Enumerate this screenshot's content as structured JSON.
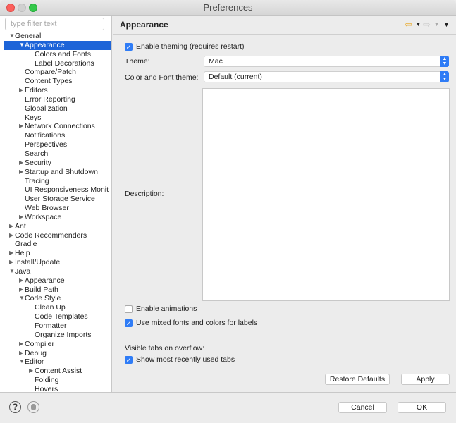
{
  "window": {
    "title": "Preferences"
  },
  "sidebar": {
    "filter_placeholder": "type filter text",
    "items": [
      {
        "label": "General",
        "level": 0,
        "state": "expanded"
      },
      {
        "label": "Appearance",
        "level": 1,
        "state": "expanded",
        "selected": true
      },
      {
        "label": "Colors and Fonts",
        "level": 2,
        "state": "leaf"
      },
      {
        "label": "Label Decorations",
        "level": 2,
        "state": "leaf"
      },
      {
        "label": "Compare/Patch",
        "level": 1,
        "state": "leaf"
      },
      {
        "label": "Content Types",
        "level": 1,
        "state": "leaf"
      },
      {
        "label": "Editors",
        "level": 1,
        "state": "collapsed"
      },
      {
        "label": "Error Reporting",
        "level": 1,
        "state": "leaf"
      },
      {
        "label": "Globalization",
        "level": 1,
        "state": "leaf"
      },
      {
        "label": "Keys",
        "level": 1,
        "state": "leaf"
      },
      {
        "label": "Network Connections",
        "level": 1,
        "state": "collapsed"
      },
      {
        "label": "Notifications",
        "level": 1,
        "state": "leaf"
      },
      {
        "label": "Perspectives",
        "level": 1,
        "state": "leaf"
      },
      {
        "label": "Search",
        "level": 1,
        "state": "leaf"
      },
      {
        "label": "Security",
        "level": 1,
        "state": "collapsed"
      },
      {
        "label": "Startup and Shutdown",
        "level": 1,
        "state": "collapsed"
      },
      {
        "label": "Tracing",
        "level": 1,
        "state": "leaf"
      },
      {
        "label": "UI Responsiveness Monit",
        "level": 1,
        "state": "leaf"
      },
      {
        "label": "User Storage Service",
        "level": 1,
        "state": "leaf"
      },
      {
        "label": "Web Browser",
        "level": 1,
        "state": "leaf"
      },
      {
        "label": "Workspace",
        "level": 1,
        "state": "collapsed"
      },
      {
        "label": "Ant",
        "level": 0,
        "state": "collapsed"
      },
      {
        "label": "Code Recommenders",
        "level": 0,
        "state": "collapsed"
      },
      {
        "label": "Gradle",
        "level": 0,
        "state": "leaf"
      },
      {
        "label": "Help",
        "level": 0,
        "state": "collapsed"
      },
      {
        "label": "Install/Update",
        "level": 0,
        "state": "collapsed"
      },
      {
        "label": "Java",
        "level": 0,
        "state": "expanded"
      },
      {
        "label": "Appearance",
        "level": 1,
        "state": "collapsed"
      },
      {
        "label": "Build Path",
        "level": 1,
        "state": "collapsed"
      },
      {
        "label": "Code Style",
        "level": 1,
        "state": "expanded"
      },
      {
        "label": "Clean Up",
        "level": 2,
        "state": "leaf"
      },
      {
        "label": "Code Templates",
        "level": 2,
        "state": "leaf"
      },
      {
        "label": "Formatter",
        "level": 2,
        "state": "leaf"
      },
      {
        "label": "Organize Imports",
        "level": 2,
        "state": "leaf"
      },
      {
        "label": "Compiler",
        "level": 1,
        "state": "collapsed"
      },
      {
        "label": "Debug",
        "level": 1,
        "state": "collapsed"
      },
      {
        "label": "Editor",
        "level": 1,
        "state": "expanded"
      },
      {
        "label": "Content Assist",
        "level": 2,
        "state": "collapsed"
      },
      {
        "label": "Folding",
        "level": 2,
        "state": "leaf"
      },
      {
        "label": "Hovers",
        "level": 2,
        "state": "leaf"
      }
    ]
  },
  "main": {
    "title": "Appearance",
    "enable_theming": {
      "label": "Enable theming (requires restart)",
      "checked": true
    },
    "theme": {
      "label": "Theme:",
      "value": "Mac"
    },
    "color_font_theme": {
      "label": "Color and Font theme:",
      "value": "Default (current)"
    },
    "description_label": "Description:",
    "enable_animations": {
      "label": "Enable animations",
      "checked": false
    },
    "mixed_fonts": {
      "label": "Use mixed fonts and colors for labels",
      "checked": true
    },
    "visible_tabs_label": "Visible tabs on overflow:",
    "show_recent_tabs": {
      "label": "Show most recently used tabs",
      "checked": true
    },
    "restore_defaults": "Restore Defaults",
    "apply": "Apply"
  },
  "footer": {
    "cancel": "Cancel",
    "ok": "OK",
    "help_icon": "?"
  },
  "colors": {
    "selection": "#1d64d8",
    "accent": "#2f7cf6"
  }
}
